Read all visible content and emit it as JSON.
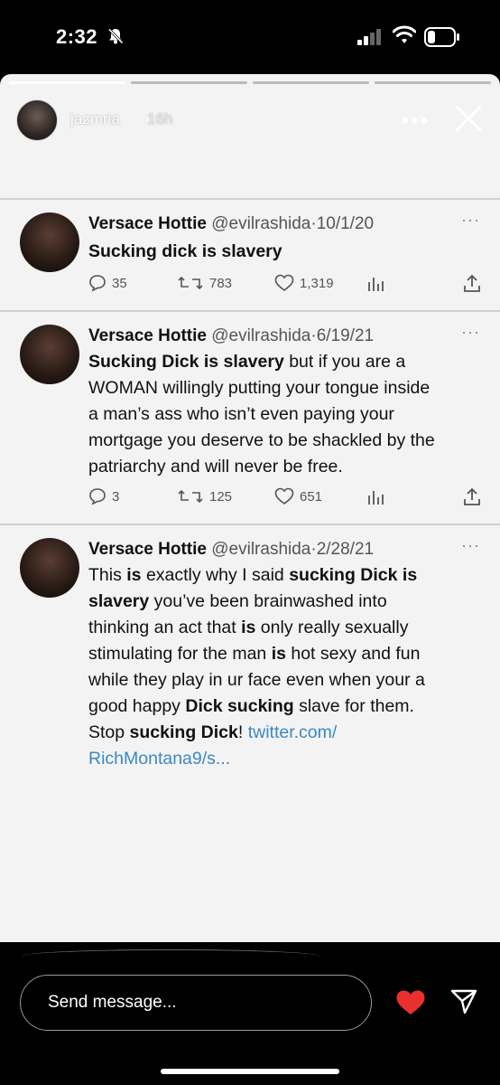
{
  "status_bar": {
    "time": "2:32",
    "icons": [
      "bell-slash-icon",
      "signal-icon",
      "wifi-icon",
      "battery-icon"
    ]
  },
  "story": {
    "username": "jazmria",
    "age": "16h",
    "more_label": "•••",
    "progress_segments": 4,
    "progress_current": 1
  },
  "tweets": [
    {
      "name": "Versace Hottie",
      "handle_date": "@evilrashida·10/1/20",
      "more": "···",
      "text_html": "<b>Sucking dick is slavery</b>",
      "replies": "35",
      "retweets": "783",
      "likes": "1,319"
    },
    {
      "name": "Versace Hottie",
      "handle_date": "@evilrashida·6/19/21",
      "more": "···",
      "text_html": "<b>Sucking Dick is slavery</b> but if you are a<br>WOMAN willingly putting your tongue inside<br>a man’s ass who isn’t even paying your<br>mortgage you deserve to be shackled by the<br>patriarchy and will never be free.",
      "replies": "3",
      "retweets": "125",
      "likes": "651"
    },
    {
      "name": "Versace Hottie",
      "handle_date": "@evilrashida·2/28/21",
      "more": "···",
      "text_html": "This <b>is</b> exactly why I said <b>sucking Dick is</b><br><b>slavery</b> you’ve been brainwashed into<br>thinking an act that <b>is</b> only really sexually<br>stimulating for the man <b>is</b> hot sexy and fun<br>while they play in ur face even when your a<br>good happy <b>Dick sucking</b> slave for them.<br>Stop <b>sucking Dick</b>! <span class=\"tlink\">twitter.com/</span><br><span class=\"tlink\">RichMontana9/s...</span>"
    }
  ],
  "bottom_bar": {
    "message_placeholder": "Send message...",
    "heart_color": "#e8302f"
  }
}
